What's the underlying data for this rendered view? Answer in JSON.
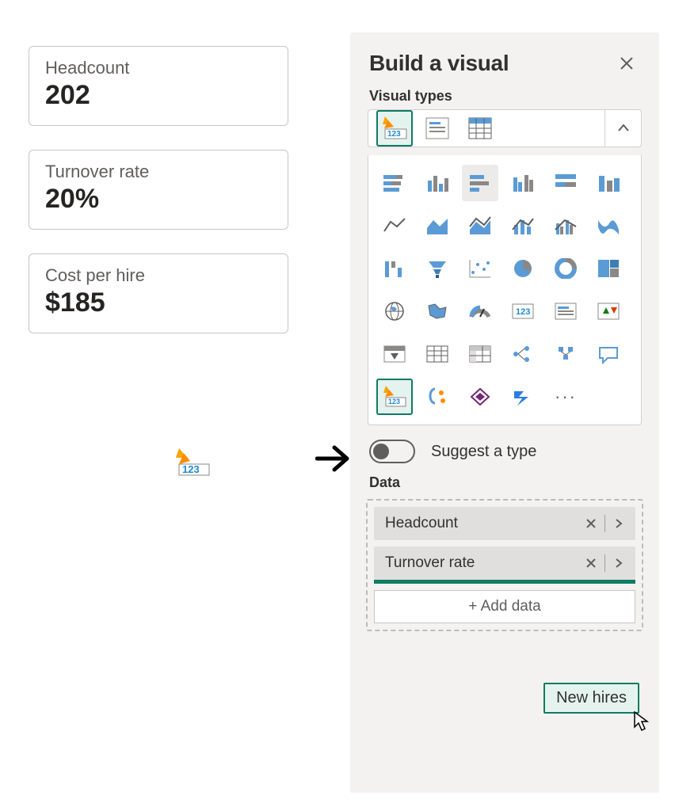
{
  "cards": [
    {
      "title": "Headcount",
      "value": "202"
    },
    {
      "title": "Turnover rate",
      "value": "20%"
    },
    {
      "title": "Cost per hire",
      "value": "$185"
    }
  ],
  "panel": {
    "title": "Build a visual",
    "visual_types_label": "Visual types",
    "suggest_label": "Suggest a type",
    "data_label": "Data",
    "add_data_label": "+ Add data",
    "more_label": "···",
    "pinned": [
      {
        "id": "smart-narrative",
        "name": "smart-narrative-icon"
      },
      {
        "id": "card-kpi",
        "name": "card-icon"
      },
      {
        "id": "table",
        "name": "table-icon"
      }
    ],
    "grid": [
      "stacked-bar",
      "clustered-column",
      "stacked-bar-h",
      "clustered-bar-h",
      "100-stacked-column",
      "column-compare",
      "line",
      "area",
      "stacked-area",
      "line-column",
      "line-clustered-column",
      "ribbon",
      "waterfall",
      "funnel",
      "scatter",
      "pie",
      "donut",
      "treemap",
      "map",
      "filled-map",
      "gauge",
      "kpi-card",
      "multi-row-card",
      "kpi",
      "slicer",
      "table",
      "matrix",
      "decomposition-tree",
      "key-influencers",
      "qna",
      "smart-narrative",
      "paginated",
      "power-apps",
      "power-automate"
    ],
    "fields": [
      {
        "label": "Headcount"
      },
      {
        "label": "Turnover rate"
      }
    ],
    "drag_item": "New hires"
  }
}
